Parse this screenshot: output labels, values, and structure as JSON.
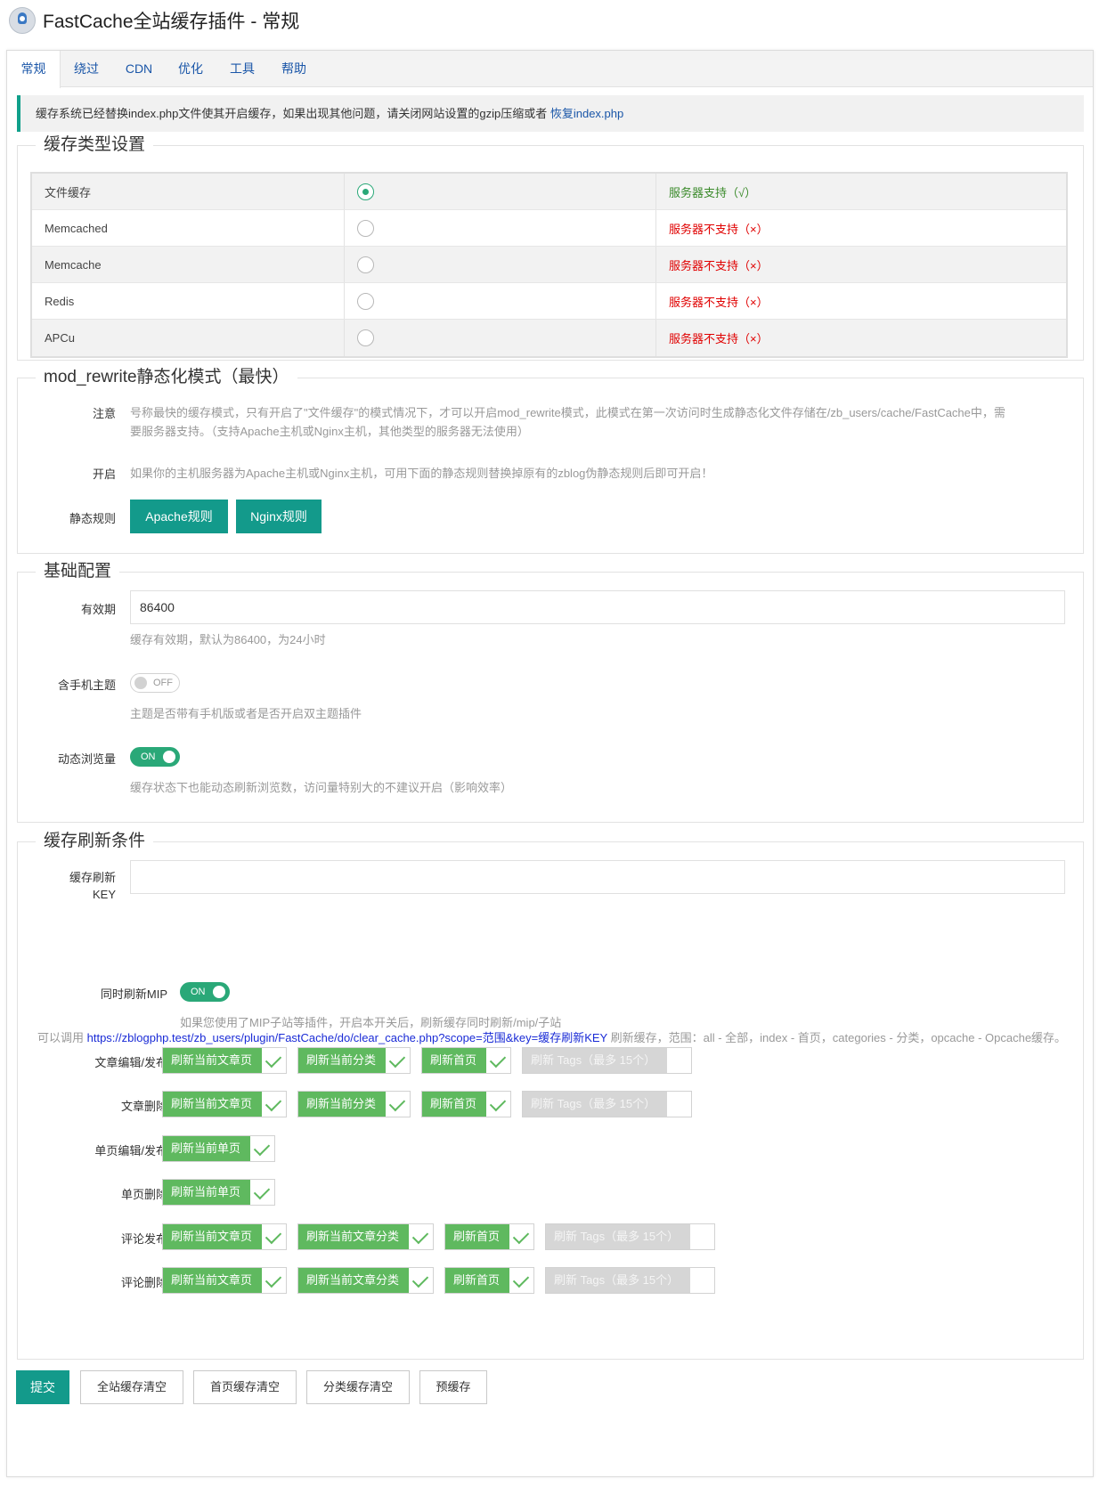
{
  "header": {
    "title": "FastCache全站缓存插件 - 常规"
  },
  "tabs": [
    {
      "label": "常规",
      "active": true
    },
    {
      "label": "绕过"
    },
    {
      "label": "CDN"
    },
    {
      "label": "优化"
    },
    {
      "label": "工具"
    },
    {
      "label": "帮助"
    }
  ],
  "notice": {
    "text": "缓存系统已经替换index.php文件使其开启缓存，如果出现其他问题，请关闭网站设置的gzip压缩或者 ",
    "link": "恢复index.php"
  },
  "cache_type": {
    "legend": "缓存类型设置",
    "rows": [
      {
        "name": "文件缓存",
        "selected": true,
        "status": "服务器支持（√）",
        "supported": true
      },
      {
        "name": "Memcached",
        "selected": false,
        "status": "服务器不支持（×）",
        "supported": false
      },
      {
        "name": "Memcache",
        "selected": false,
        "status": "服务器不支持（×）",
        "supported": false
      },
      {
        "name": "Redis",
        "selected": false,
        "status": "服务器不支持（×）",
        "supported": false
      },
      {
        "name": "APCu",
        "selected": false,
        "status": "服务器不支持（×）",
        "supported": false
      }
    ],
    "status_colors": {
      "ok": "#3a8a2a",
      "bad": "#e00000"
    }
  },
  "rewrite": {
    "legend": "mod_rewrite静态化模式（最快）",
    "note_label": "注意",
    "note_text": "号称最快的缓存模式，只有开启了\"文件缓存\"的模式情况下，才可以开启mod_rewrite模式，此模式在第一次访问时生成静态化文件存储在/zb_users/cache/FastCache中，需要服务器支持。（支持Apache主机或Nginx主机，其他类型的服务器无法使用）",
    "enable_label": "开启",
    "enable_text": "如果你的主机服务器为Apache主机或Nginx主机，可用下面的静态规则替换掉原有的zblog伪静态规则后即可开启！",
    "rules_label": "静态规则",
    "apache_button": "Apache规则",
    "nginx_button": "Nginx规则"
  },
  "basic": {
    "legend": "基础配置",
    "expire_label": "有效期",
    "expire_value": "86400",
    "expire_help": "缓存有效期，默认为86400，为24小时",
    "mobile_label": "含手机主题",
    "mobile_switch": "OFF",
    "mobile_help": "主题是否带有手机版或者是否开启双主题插件",
    "views_label": "动态浏览量",
    "views_switch": "ON",
    "views_help": "缓存状态下也能动态刷新浏览数，访问量特别大的不建议开启（影响效率）"
  },
  "refresh": {
    "legend": "缓存刷新条件",
    "key_label_1": "缓存刷新",
    "key_label_2": "KEY",
    "key_value": "",
    "url_prefix": "可以调用 ",
    "url": "https://zblogphp.test/zb_users/plugin/FastCache/do/clear_cache.php?scope=范围&key=缓存刷新KEY",
    "url_suffix": " 刷新缓存，范围：all - 全部，index - 首页，categories - 分类，opcache - Opcache缓存。",
    "mip_label": "同时刷新MIP",
    "mip_switch": "ON",
    "mip_help": "如果您使用了MIP子站等插件，开启本开关后，刷新缓存同时刷新/mip/子站",
    "rows": [
      {
        "label": "文章编辑/发布",
        "items": [
          {
            "text": "刷新当前文章页",
            "checked": true
          },
          {
            "text": "刷新当前分类",
            "checked": true
          },
          {
            "text": "刷新首页",
            "checked": true
          },
          {
            "text": "刷新 Tags（最多 15个）",
            "checked": false
          }
        ]
      },
      {
        "label": "文章删除",
        "items": [
          {
            "text": "刷新当前文章页",
            "checked": true
          },
          {
            "text": "刷新当前分类",
            "checked": true
          },
          {
            "text": "刷新首页",
            "checked": true
          },
          {
            "text": "刷新 Tags（最多 15个）",
            "checked": false
          }
        ]
      },
      {
        "label": "单页编辑/发布",
        "items": [
          {
            "text": "刷新当前单页",
            "checked": true
          }
        ]
      },
      {
        "label": "单页删除",
        "items": [
          {
            "text": "刷新当前单页",
            "checked": true
          }
        ]
      },
      {
        "label": "评论发布",
        "items": [
          {
            "text": "刷新当前文章页",
            "checked": true
          },
          {
            "text": "刷新当前文章分类",
            "checked": true
          },
          {
            "text": "刷新首页",
            "checked": true
          },
          {
            "text": "刷新 Tags（最多 15个）",
            "checked": false
          }
        ]
      },
      {
        "label": "评论删除",
        "items": [
          {
            "text": "刷新当前文章页",
            "checked": true
          },
          {
            "text": "刷新当前文章分类",
            "checked": true
          },
          {
            "text": "刷新首页",
            "checked": true
          },
          {
            "text": "刷新 Tags（最多 15个）",
            "checked": false
          }
        ]
      }
    ]
  },
  "actions": {
    "submit": "提交",
    "clear_all": "全站缓存清空",
    "clear_home": "首页缓存清空",
    "clear_category": "分类缓存清空",
    "precache": "预缓存"
  },
  "colors": {
    "accent": "#139a8b",
    "check": "#5fb95f",
    "switch_on": "#2aa878",
    "link": "#1a56a8"
  }
}
